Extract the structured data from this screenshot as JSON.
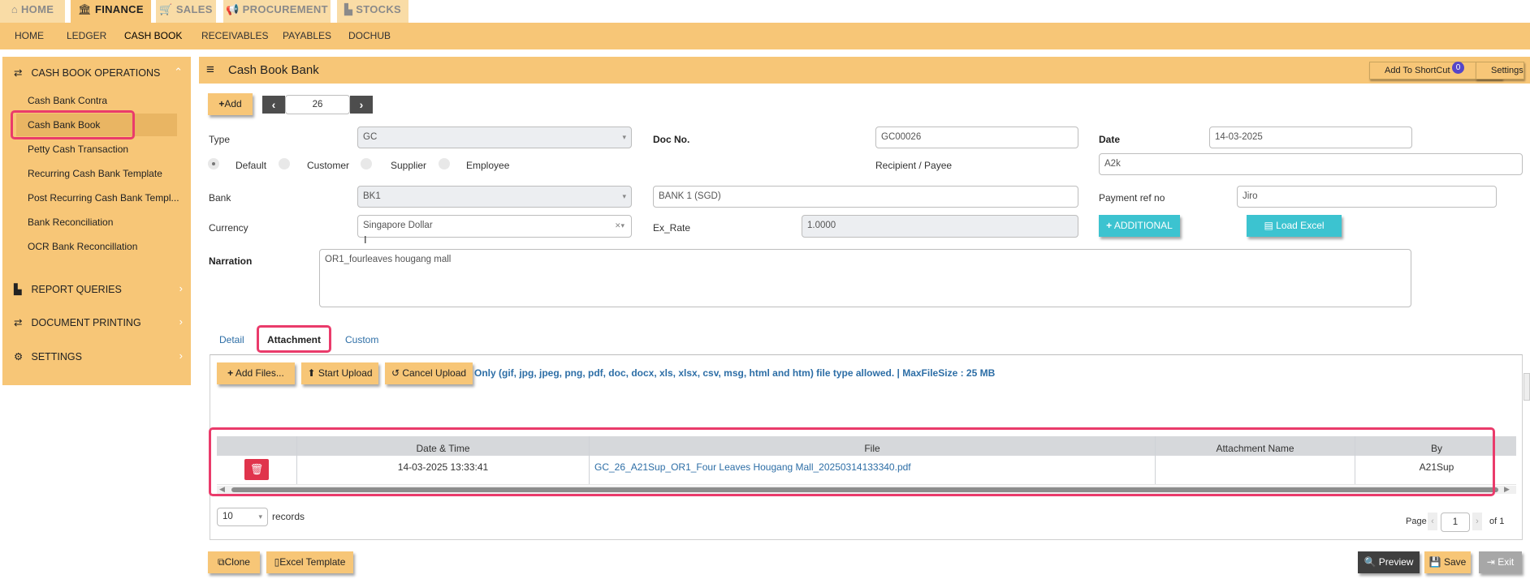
{
  "top_tabs": [
    {
      "label": "HOME",
      "icon": "home-icon"
    },
    {
      "label": "FINANCE",
      "icon": "bank-icon"
    },
    {
      "label": "SALES",
      "icon": "cart-icon"
    },
    {
      "label": "PROCUREMENT",
      "icon": "megaphone-icon"
    },
    {
      "label": "STOCKS",
      "icon": "bar-chart-icon"
    }
  ],
  "sub_nav": [
    "HOME",
    "LEDGER",
    "CASH BOOK",
    "RECEIVABLES",
    "PAYABLES",
    "DOCHUB"
  ],
  "sidebar": {
    "sections": [
      {
        "label": "CASH BOOK OPERATIONS",
        "icon": "exchange-icon"
      },
      {
        "label": "REPORT QUERIES",
        "icon": "bar-chart-icon"
      },
      {
        "label": "DOCUMENT PRINTING",
        "icon": "exchange-icon"
      },
      {
        "label": "SETTINGS",
        "icon": "cogs-icon"
      }
    ],
    "items": [
      "Cash Bank Contra",
      "Cash Bank Book",
      "Petty Cash Transaction",
      "Recurring Cash Bank Template",
      "Post Recurring Cash Bank Templ...",
      "Bank Reconciliation",
      "OCR Bank Reconcillation"
    ]
  },
  "header": {
    "title": "Cash Book Bank",
    "shortcut_label": "Add To ShortCut",
    "shortcut_count": "0",
    "settings_label": "Settings"
  },
  "toolbar": {
    "add_label": "Add",
    "record_number": "26"
  },
  "form": {
    "type_label": "Type",
    "type_value": "GC",
    "docno_label": "Doc No.",
    "docno_value": "GC00026",
    "date_label": "Date",
    "date_value": "14-03-2025",
    "radio_options": [
      "Default",
      "Customer",
      "Supplier",
      "Employee"
    ],
    "recipient_label": "Recipient / Payee",
    "recipient_value": "A2k",
    "bank_label": "Bank",
    "bank_value": "BK1",
    "bank_name_value": "BANK 1 (SGD)",
    "payment_ref_label": "Payment ref no",
    "payment_ref_value": "Jiro",
    "currency_label": "Currency",
    "currency_value": "Singapore Dollar",
    "exrate_label": "Ex_Rate",
    "exrate_value": "1.0000",
    "additional_label": "ADDITIONAL",
    "load_excel_label": "Load Excel",
    "narration_label": "Narration",
    "narration_value": "OR1_fourleaves hougang mall"
  },
  "tabs": [
    "Detail",
    "Attachment",
    "Custom"
  ],
  "attachment": {
    "add_files_label": "Add Files...",
    "start_upload_label": "Start Upload",
    "cancel_upload_label": "Cancel Upload",
    "info_text": "Only (gif, jpg, jpeg, png, pdf, doc, docx, xls, xlsx, csv, msg, html and htm) file type allowed. | MaxFileSize : 25 MB",
    "columns": [
      "Date & Time",
      "File",
      "Attachment Name",
      "By"
    ],
    "rows": [
      {
        "datetime": "14-03-2025 13:33:41",
        "file": "GC_26_A21Sup_OR1_Four Leaves Hougang Mall_20250314133340.pdf",
        "attachment_name": "",
        "by": "A21Sup"
      }
    ],
    "page_size": "10",
    "records_label": "records",
    "page_label": "Page",
    "page_value": "1",
    "of_label": "of 1"
  },
  "footer": {
    "clone_label": "Clone",
    "excel_template_label": "Excel Template",
    "preview_label": "Preview",
    "save_label": "Save",
    "exit_label": "Exit"
  },
  "colors": {
    "accent": "#f7c677",
    "teal": "#3cc3d0",
    "highlight": "#ea3b6b",
    "link": "#2d6ea6",
    "delete": "#e0344c"
  }
}
